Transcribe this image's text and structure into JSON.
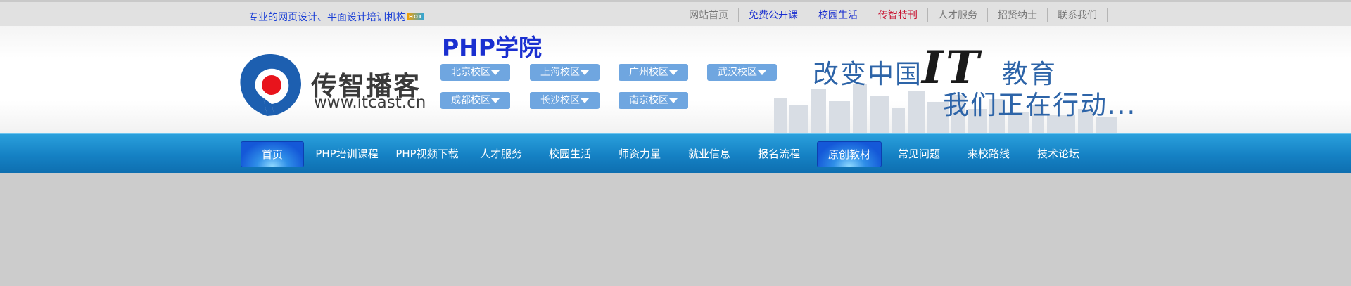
{
  "topbar": {
    "tagline": "专业的网页设计、平面设计培训机构",
    "hot_badge": "HOT",
    "links": [
      {
        "label": "网站首页",
        "color": "#777777"
      },
      {
        "label": "免费公开课",
        "color": "#1a2fd0"
      },
      {
        "label": "校园生活",
        "color": "#1a2fd0"
      },
      {
        "label": "传智特刊",
        "color": "#c8102e"
      },
      {
        "label": "人才服务",
        "color": "#777777"
      },
      {
        "label": "招贤纳士",
        "color": "#777777"
      },
      {
        "label": "联系我们",
        "color": "#777777"
      }
    ]
  },
  "header": {
    "logo_name": "传智播客",
    "logo_url": "www.itcast.cn",
    "title": "PHP学院",
    "campuses": [
      {
        "label": "北京校区"
      },
      {
        "label": "上海校区"
      },
      {
        "label": "广州校区"
      },
      {
        "label": "武汉校区"
      },
      {
        "label": "成都校区"
      },
      {
        "label": "长沙校区"
      },
      {
        "label": "南京校区"
      }
    ],
    "slogan_a": "改变中国",
    "slogan_it": "IT",
    "slogan_b": "教育",
    "slogan_c": "我们正在行动..."
  },
  "nav": {
    "items": [
      {
        "label": "首页",
        "active": true
      },
      {
        "label": "PHP培训课程",
        "active": false
      },
      {
        "label": "PHP视频下载",
        "active": false
      },
      {
        "label": "人才服务",
        "active": false
      },
      {
        "label": "校园生活",
        "active": false
      },
      {
        "label": "师资力量",
        "active": false
      },
      {
        "label": "就业信息",
        "active": false
      },
      {
        "label": "报名流程",
        "active": false
      },
      {
        "label": "原创教材",
        "active": true
      },
      {
        "label": "常见问题",
        "active": false
      },
      {
        "label": "来校路线",
        "active": false
      },
      {
        "label": "技术论坛",
        "active": false
      }
    ]
  },
  "colors": {
    "brand_blue": "#1a2fd0",
    "nav_blue": "#1581c4",
    "campus_blue": "#6fa6e0",
    "logo_red": "#e8141c",
    "logo_blue": "#1d5fb0"
  }
}
